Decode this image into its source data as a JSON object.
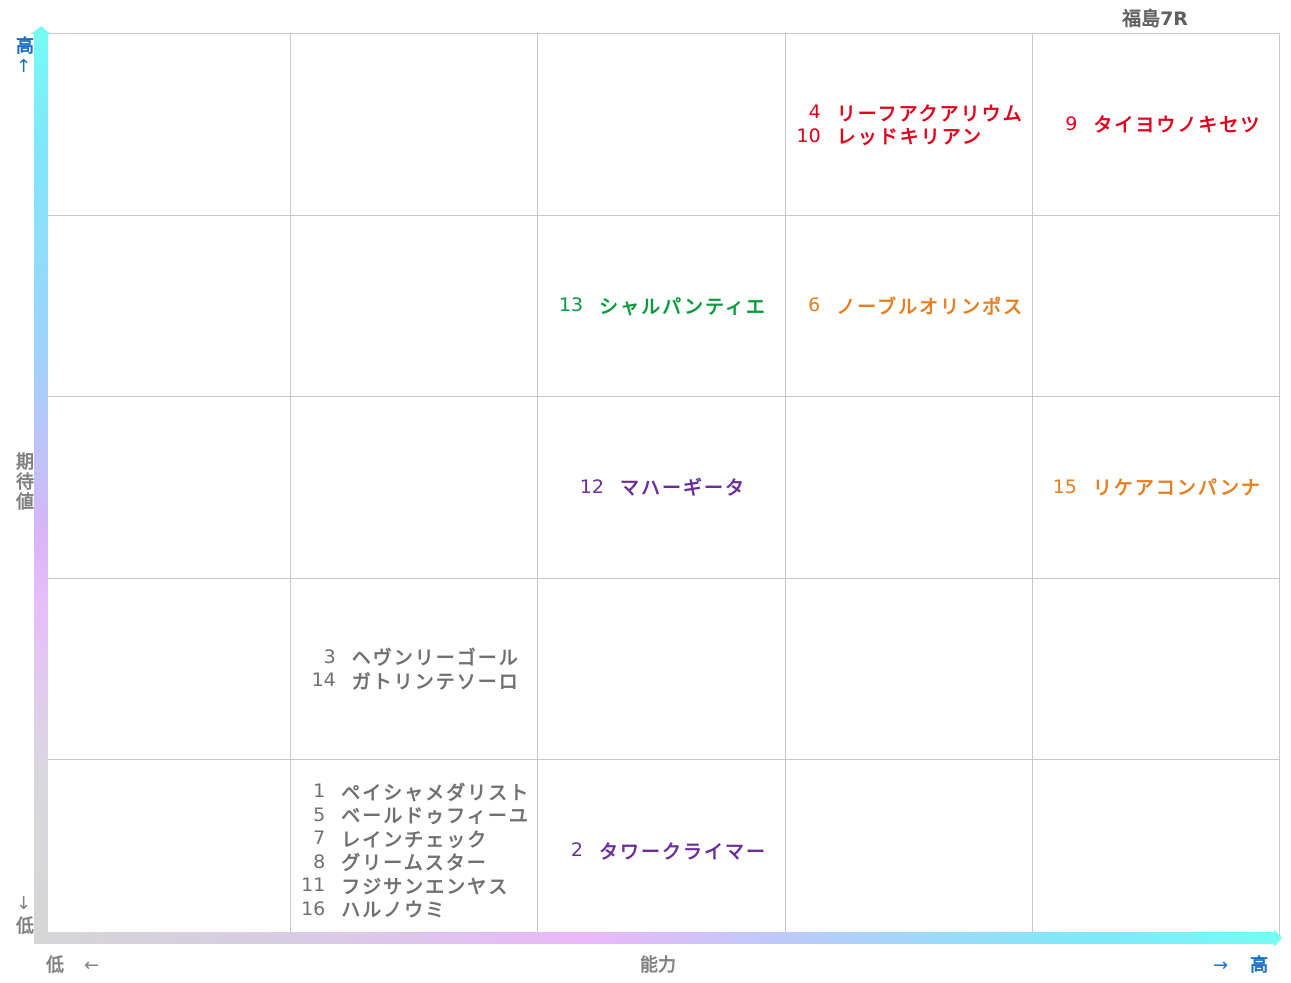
{
  "title": "福島7R",
  "y_axis": {
    "label": "期待値",
    "high": "高",
    "high_arrow": "↑",
    "low": "低",
    "low_arrow": "↓"
  },
  "x_axis": {
    "label": "能力",
    "low": "低",
    "low_arrow": "←",
    "high": "高",
    "high_arrow": "→"
  },
  "colors": {
    "red": "#e0001b",
    "orange": "#e67e22",
    "green": "#0a9a3d",
    "purple": "#6b2d9a",
    "gray": "#707070",
    "axis_blue": "#1a6fc7",
    "axis_gray": "#808080"
  },
  "chart_data": {
    "type": "table",
    "title": "福島7R",
    "xlabel": "能力",
    "ylabel": "期待値",
    "columns": 5,
    "rows": 5,
    "cells": [
      {
        "col": 3,
        "row": 0,
        "color": "red",
        "entries": [
          {
            "num": "4",
            "name": "リーフアクアリウム"
          },
          {
            "num": "10",
            "name": "レッドキリアン"
          }
        ]
      },
      {
        "col": 4,
        "row": 0,
        "color": "red",
        "entries": [
          {
            "num": "9",
            "name": "タイヨウノキセツ"
          }
        ]
      },
      {
        "col": 2,
        "row": 1,
        "color": "green",
        "entries": [
          {
            "num": "13",
            "name": "シャルパンティエ"
          }
        ]
      },
      {
        "col": 3,
        "row": 1,
        "color": "orange",
        "entries": [
          {
            "num": "6",
            "name": "ノーブルオリンポス"
          }
        ]
      },
      {
        "col": 2,
        "row": 2,
        "color": "purple",
        "entries": [
          {
            "num": "12",
            "name": "マハーギータ"
          }
        ]
      },
      {
        "col": 4,
        "row": 2,
        "color": "orange",
        "entries": [
          {
            "num": "15",
            "name": "リケアコンパンナ"
          }
        ]
      },
      {
        "col": 1,
        "row": 3,
        "color": "gray",
        "entries": [
          {
            "num": "3",
            "name": "ヘヴンリーゴール"
          },
          {
            "num": "14",
            "name": "ガトリンテソーロ"
          }
        ]
      },
      {
        "col": 1,
        "row": 4,
        "color": "gray",
        "entries": [
          {
            "num": "1",
            "name": "ペイシャメダリスト"
          },
          {
            "num": "5",
            "name": "ベールドゥフィーユ"
          },
          {
            "num": "7",
            "name": "レインチェック"
          },
          {
            "num": "8",
            "name": "グリームスター"
          },
          {
            "num": "11",
            "name": "フジサンエンヤス"
          },
          {
            "num": "16",
            "name": "ハルノウミ"
          }
        ]
      },
      {
        "col": 2,
        "row": 4,
        "color": "purple",
        "entries": [
          {
            "num": "2",
            "name": "タワークライマー"
          }
        ]
      }
    ]
  }
}
